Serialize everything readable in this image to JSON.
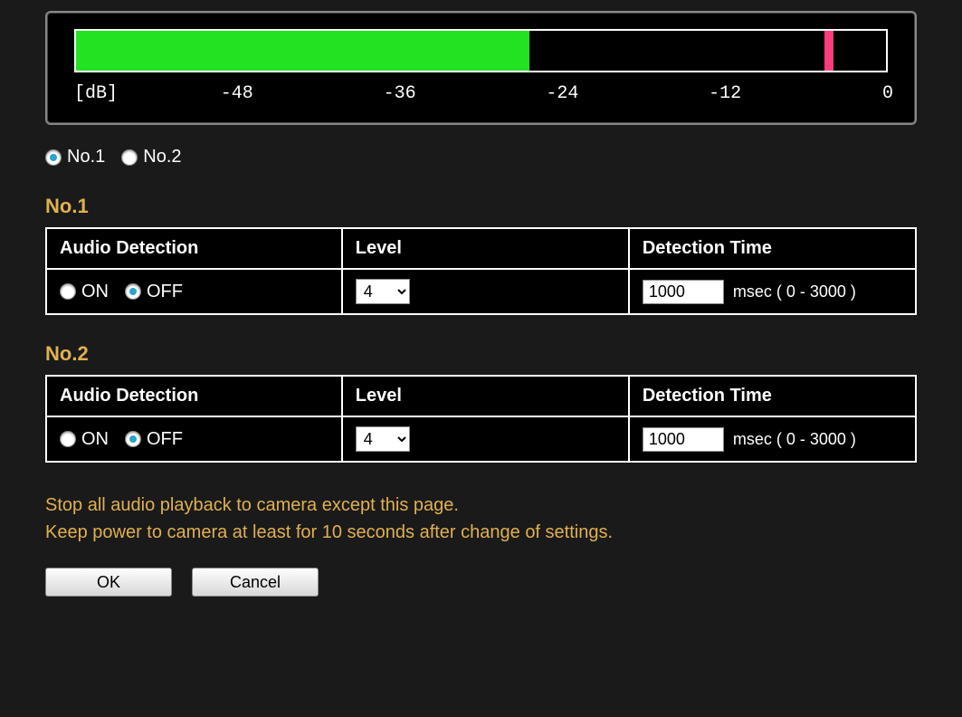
{
  "meter": {
    "unit_label": "[dB]",
    "ticks": [
      {
        "label": "-48",
        "pos_pct": 20
      },
      {
        "label": "-36",
        "pos_pct": 40
      },
      {
        "label": "-24",
        "pos_pct": 60
      },
      {
        "label": "-12",
        "pos_pct": 80
      },
      {
        "label": "0",
        "pos_pct": 100
      }
    ],
    "fill_pct": 56,
    "marker_pct": 93
  },
  "selector": {
    "options": [
      "No.1",
      "No.2"
    ],
    "selected": "No.1"
  },
  "sections": [
    {
      "heading": "No.1",
      "headers": {
        "col1": "Audio Detection",
        "col2": "Level",
        "col3": "Detection Time"
      },
      "audio_detection": {
        "on_label": "ON",
        "off_label": "OFF",
        "value": "OFF"
      },
      "level": "4",
      "detection_time": {
        "value": "1000",
        "unit_hint": "msec ( 0 - 3000 )"
      }
    },
    {
      "heading": "No.2",
      "headers": {
        "col1": "Audio Detection",
        "col2": "Level",
        "col3": "Detection Time"
      },
      "audio_detection": {
        "on_label": "ON",
        "off_label": "OFF",
        "value": "OFF"
      },
      "level": "4",
      "detection_time": {
        "value": "1000",
        "unit_hint": "msec ( 0 - 3000 )"
      }
    }
  ],
  "notes": {
    "line1": "Stop all audio playback to camera except this page.",
    "line2": "Keep power to camera at least for 10 seconds after change of settings."
  },
  "buttons": {
    "ok": "OK",
    "cancel": "Cancel"
  }
}
